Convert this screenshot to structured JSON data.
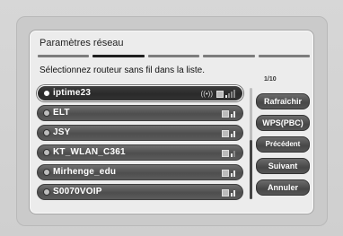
{
  "window": {
    "title": "Paramètres réseau"
  },
  "wizard": {
    "steps": 5,
    "active_step": 2
  },
  "instruction": "Sélectionnez routeur sans fil dans la liste.",
  "page_indicator": "1/10",
  "networks": [
    {
      "name": "iptime23",
      "selected": true,
      "secured": true,
      "signal": 1,
      "icon": "wifi-secure-icon"
    },
    {
      "name": "ELT",
      "selected": false,
      "secured": true,
      "signal": 2,
      "icon": "lock-icon"
    },
    {
      "name": "JSY",
      "selected": false,
      "secured": true,
      "signal": 2,
      "icon": "lock-icon"
    },
    {
      "name": "KT_WLAN_C361",
      "selected": false,
      "secured": true,
      "signal": 1,
      "icon": "lock-icon"
    },
    {
      "name": "Mirhenge_edu",
      "selected": false,
      "secured": true,
      "signal": 2,
      "icon": "lock-icon"
    },
    {
      "name": "S0070VOIP",
      "selected": false,
      "secured": true,
      "signal": 2,
      "icon": "lock-icon"
    }
  ],
  "buttons": {
    "refresh": "Rafraîchir",
    "wps": "WPS(PBC)",
    "previous": "Précédent",
    "next": "Suivant",
    "cancel": "Annuler"
  },
  "colors": {
    "selected_border": "#ffffff",
    "row_bg": "#555555",
    "active_tab": "#1f1f1f"
  }
}
